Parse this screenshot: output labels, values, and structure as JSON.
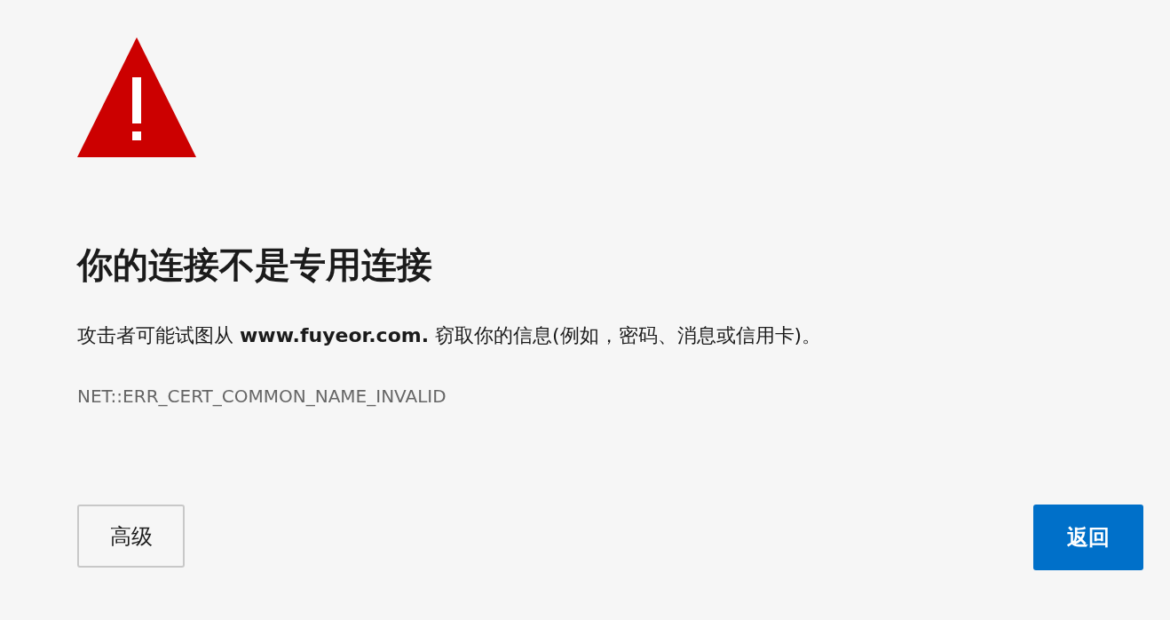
{
  "heading": "你的连接不是专用连接",
  "message": "攻击者可能试图从 **www.fuyeor.com.** 窃取你的信息(例如，密码、消息或信用卡)。",
  "error_code": "NET::ERR_CERT_COMMON_NAME_INVALID",
  "buttons": [
    {
      "label": "高级",
      "kind": "secondary"
    },
    {
      "label": "返回",
      "kind": "primary"
    }
  ]
}
